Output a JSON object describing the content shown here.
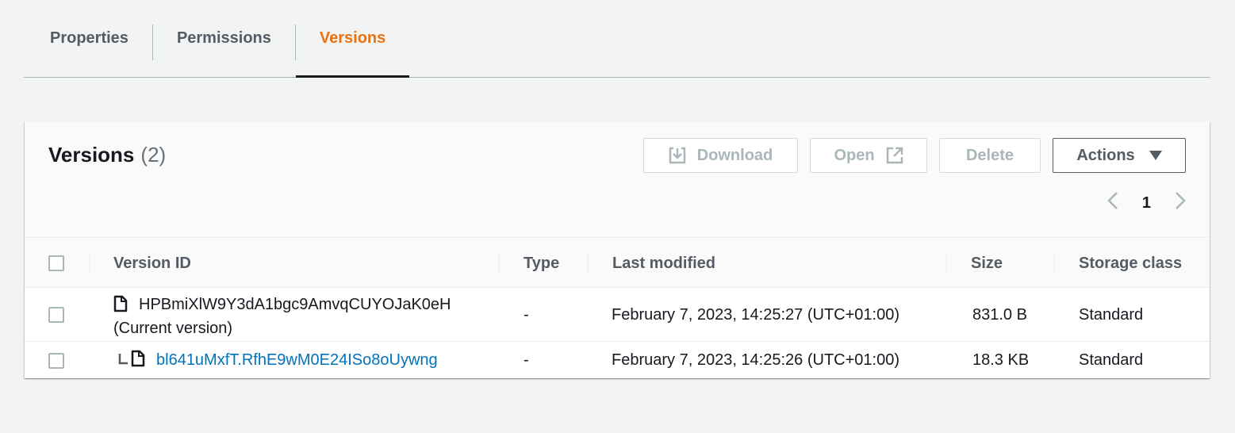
{
  "tabs": [
    {
      "label": "Properties",
      "active": false
    },
    {
      "label": "Permissions",
      "active": false
    },
    {
      "label": "Versions",
      "active": true
    }
  ],
  "panel": {
    "title": "Versions",
    "count": "(2)",
    "buttons": {
      "download": {
        "label": "Download",
        "icon": "download-icon",
        "disabled": true
      },
      "open": {
        "label": "Open",
        "icon": "external-link-icon",
        "disabled": true
      },
      "delete": {
        "label": "Delete",
        "disabled": true
      },
      "actions": {
        "label": "Actions",
        "icon": "caret-down-icon",
        "disabled": false
      }
    },
    "pagination": {
      "current_page": "1"
    }
  },
  "table": {
    "columns": [
      "Version ID",
      "Type",
      "Last modified",
      "Size",
      "Storage class"
    ],
    "rows": [
      {
        "version_id": "HPBmiXlW9Y3dA1bgc9AmvqCUYOJaK0eH",
        "note": "(Current version)",
        "type": "-",
        "last_modified": "February 7, 2023, 14:25:27 (UTC+01:00)",
        "size": "831.0 B",
        "storage_class": "Standard",
        "is_link": false
      },
      {
        "version_id": "bl641uMxfT.RfhE9wM0E24ISo8oUywng",
        "note": "",
        "type": "-",
        "last_modified": "February 7, 2023, 14:25:26 (UTC+01:00)",
        "size": "18.3 KB",
        "storage_class": "Standard",
        "is_link": true
      }
    ]
  },
  "colors": {
    "active_tab": "#ec7211",
    "link": "#0073bb",
    "disabled": "#aab7b8"
  }
}
